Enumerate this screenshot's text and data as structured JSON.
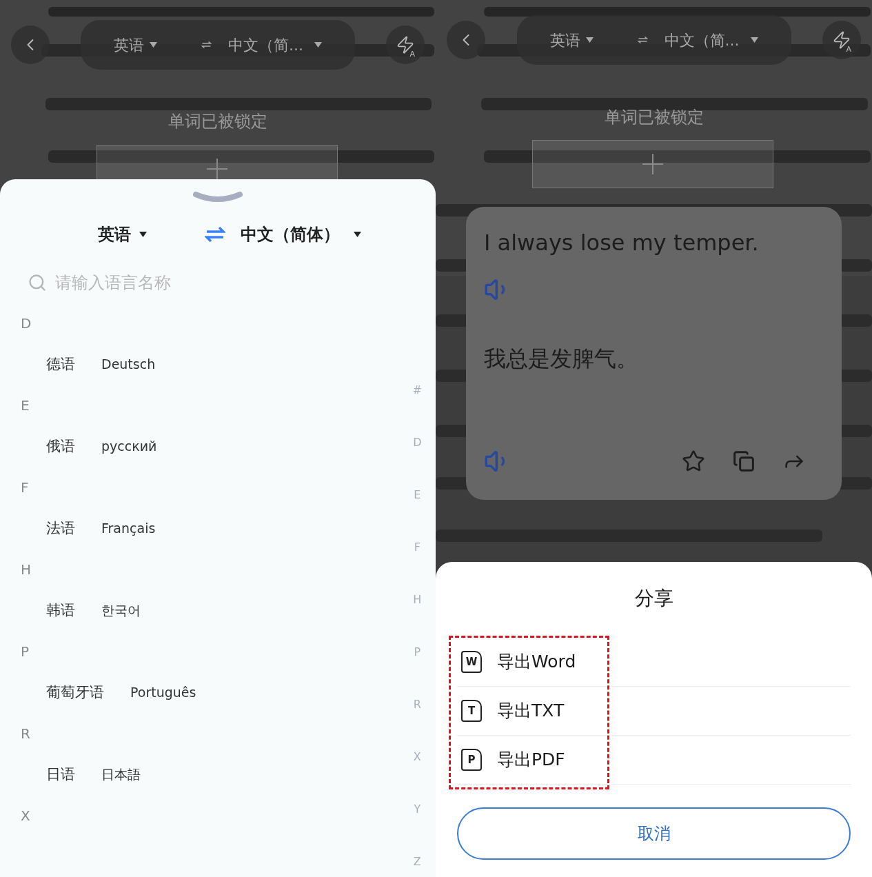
{
  "left_screen": {
    "top_bar": {
      "source_language": "英语",
      "target_language": "中文（简...",
      "flash_badge": "A"
    },
    "lock_notice": "单词已被锁定",
    "language_sheet": {
      "source_language": "英语",
      "target_language": "中文（简体）",
      "search": {
        "placeholder": "请输入语言名称"
      },
      "sections": [
        {
          "letter": "D",
          "languages": [
            {
              "name": "德语",
              "native_name": "Deutsch"
            }
          ]
        },
        {
          "letter": "E",
          "languages": [
            {
              "name": "俄语",
              "native_name": "русский"
            }
          ]
        },
        {
          "letter": "F",
          "languages": [
            {
              "name": "法语",
              "native_name": "Français"
            }
          ]
        },
        {
          "letter": "H",
          "languages": [
            {
              "name": "韩语",
              "native_name": "한국어"
            }
          ]
        },
        {
          "letter": "P",
          "languages": [
            {
              "name": "葡萄牙语",
              "native_name": "Português"
            }
          ]
        },
        {
          "letter": "R",
          "languages": [
            {
              "name": "日语",
              "native_name": "日本語"
            }
          ]
        },
        {
          "letter": "X"
        }
      ],
      "index_letters": [
        "#",
        "D",
        "E",
        "F",
        "H",
        "P",
        "R",
        "X",
        "Y",
        "Z"
      ]
    }
  },
  "right_screen": {
    "top_bar": {
      "source_language": "英语",
      "target_language": "中文（简...",
      "flash_badge": "A"
    },
    "lock_notice": "单词已被锁定",
    "translation_card": {
      "source_text": "I always lose my temper.",
      "translated_text": "我总是发脾气。"
    },
    "share_sheet": {
      "title": "分享",
      "highlighted": true,
      "options": [
        {
          "label": "导出Word",
          "icon_letter": "W"
        },
        {
          "label": "导出TXT",
          "icon_letter": "T"
        },
        {
          "label": "导出PDF",
          "icon_letter": "P"
        }
      ],
      "cancel": "取消"
    }
  }
}
